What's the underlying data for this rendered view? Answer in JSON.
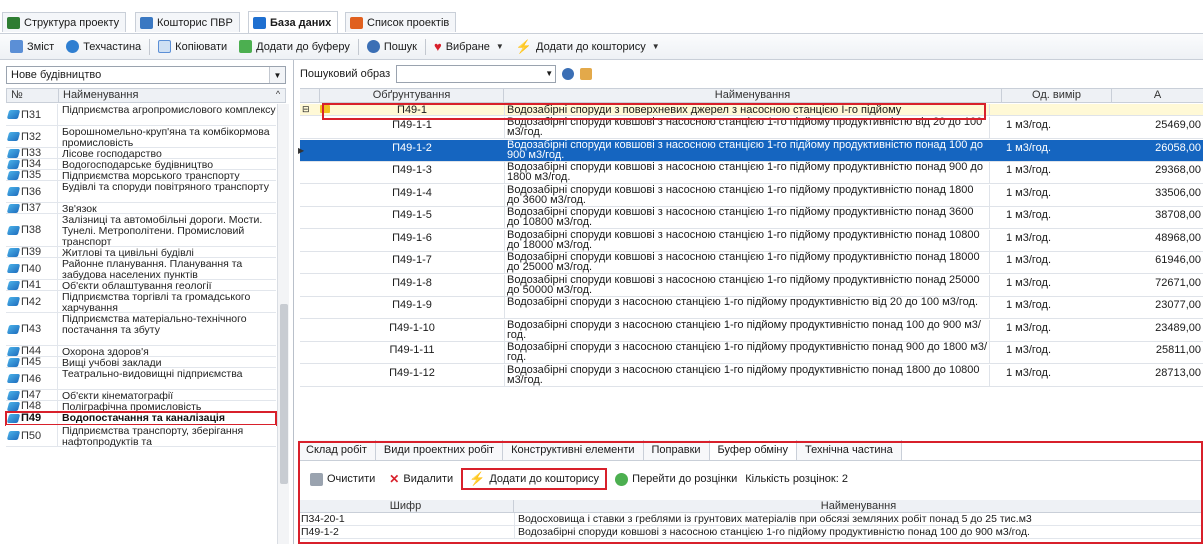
{
  "tabs": [
    {
      "label": "Структура проекту",
      "icon": "structure-icon",
      "color": "#2e7d32"
    },
    {
      "label": "Кошторис ПВР",
      "icon": "table-icon",
      "color": "#3a78c2"
    },
    {
      "label": "База даних",
      "icon": "database-icon",
      "color": "#1e6fd0"
    },
    {
      "label": "Список проектів",
      "icon": "list-icon",
      "color": "#e0601f"
    }
  ],
  "toolbar": {
    "contents": "Зміст",
    "techpart": "Техчастина",
    "copy": "Копіювати",
    "add_buffer": "Додати до буферу",
    "search": "Пошук",
    "favorites": "Вибране",
    "add_estimate": "Додати до кошторису"
  },
  "left": {
    "combo_value": "Нове будівництво",
    "col_num": "№",
    "col_name": "Найменування",
    "items": [
      {
        "code": "П31",
        "name": "Підприємства агропромислового комплексу"
      },
      {
        "code": "П32",
        "name": "Борошномельно-круп'яна та комбікормова промисловість"
      },
      {
        "code": "П33",
        "name": "Лісове господарство"
      },
      {
        "code": "П34",
        "name": "Водогосподарське будівництво"
      },
      {
        "code": "П35",
        "name": "Підприємства морського транспорту"
      },
      {
        "code": "П36",
        "name": "Будівлі та споруди повітряного транспорту"
      },
      {
        "code": "П37",
        "name": "Зв'язок"
      },
      {
        "code": "П38",
        "name": "Залізниці та автомобільні дороги. Мости. Тунелі. Метрополітени. Промисловий транспорт"
      },
      {
        "code": "П39",
        "name": "Житлові та цивільні будівлі"
      },
      {
        "code": "П40",
        "name": "Районне планування. Планування та забудова населених пунктів"
      },
      {
        "code": "П41",
        "name": "Об'єкти облаштування геології"
      },
      {
        "code": "П42",
        "name": "Підприємства торгівлі та громадського харчування"
      },
      {
        "code": "П43",
        "name": "Підприємства матеріально-технічного постачання та збуту"
      },
      {
        "code": "П44",
        "name": "Охорона здоров'я"
      },
      {
        "code": "П45",
        "name": "Вищі учбові заклади"
      },
      {
        "code": "П46",
        "name": "Театрально-видовищні підприємства"
      },
      {
        "code": "П47",
        "name": "Об'єкти кінематографії"
      },
      {
        "code": "П48",
        "name": "Поліграфічна промисловість"
      },
      {
        "code": "П49",
        "name": "Водопостачання та каналізація"
      },
      {
        "code": "П50",
        "name": "Підприємства транспорту, зберігання нафтопродуктів та"
      }
    ]
  },
  "search": {
    "label": "Пошуковий образ",
    "value": ""
  },
  "grid": {
    "headers": {
      "code": "Обґрунтування",
      "name": "Найменування",
      "unit": "Од. вимір",
      "a": "A"
    },
    "group": {
      "code": "П49-1",
      "name": "Водозабірні споруди з поверхневих джерел з насосною станцією І-го підйому"
    },
    "rows": [
      {
        "code": "П49-1-1",
        "name": "Водозабірні споруди ковшові з насосною станцією 1-го підйому продуктивністю від 20 до 100 м3/год.",
        "unit": "1 м3/год.",
        "a": "25469,00"
      },
      {
        "code": "П49-1-2",
        "name": "Водозабірні споруди ковшові з насосною станцією 1-го підйому продуктивністю понад 100 до 900 м3/год.",
        "unit": "1 м3/год.",
        "a": "26058,00"
      },
      {
        "code": "П49-1-3",
        "name": "Водозабірні споруди ковшові з насосною станцією 1-го підйому продуктивністю понад 900 до 1800 м3/год.",
        "unit": "1 м3/год.",
        "a": "29368,00"
      },
      {
        "code": "П49-1-4",
        "name": "Водозабірні споруди ковшові з насосною станцією 1-го підйому продуктивністю понад 1800 до 3600 м3/год.",
        "unit": "1 м3/год.",
        "a": "33506,00"
      },
      {
        "code": "П49-1-5",
        "name": "Водозабірні споруди ковшові з насосною станцією 1-го підйому продуктивністю понад 3600 до 10800 м3/год.",
        "unit": "1 м3/год.",
        "a": "38708,00"
      },
      {
        "code": "П49-1-6",
        "name": "Водозабірні споруди ковшові з насосною станцією 1-го підйому продуктивністю понад 10800 до 18000 м3/год.",
        "unit": "1 м3/год.",
        "a": "48968,00"
      },
      {
        "code": "П49-1-7",
        "name": "Водозабірні споруди ковшові з насосною станцією 1-го підйому продуктивністю понад 18000 до 25000 м3/год.",
        "unit": "1 м3/год.",
        "a": "61946,00"
      },
      {
        "code": "П49-1-8",
        "name": "Водозабірні споруди ковшові з насосною станцією 1-го підйому продуктивністю понад 25000 до 50000 м3/год.",
        "unit": "1 м3/год.",
        "a": "72671,00"
      },
      {
        "code": "П49-1-9",
        "name": "Водозабірні споруди з насосною станцією 1-го підйому продуктивністю від 20 до 100 м3/год.",
        "unit": "1 м3/год.",
        "a": "23077,00"
      },
      {
        "code": "П49-1-10",
        "name": "Водозабірні споруди з насосною станцією 1-го підйому продуктивністю понад 100 до 900 м3/год.",
        "unit": "1 м3/год.",
        "a": "23489,00"
      },
      {
        "code": "П49-1-11",
        "name": "Водозабірні споруди з насосною станцією 1-го підйому продуктивністю понад 900 до 1800 м3/год.",
        "unit": "1 м3/год.",
        "a": "25811,00"
      },
      {
        "code": "П49-1-12",
        "name": "Водозабірні споруди з насосною станцією 1-го підйому продуктивністю понад 1800 до 10800 м3/год.",
        "unit": "1 м3/год.",
        "a": "28713,00"
      }
    ]
  },
  "bottom": {
    "tabs": [
      "Склад робіт",
      "Види проектних робіт",
      "Конструктивні елементи",
      "Поправки",
      "Буфер обміну",
      "Технічна частина"
    ],
    "clear": "Очистити",
    "delete": "Видалити",
    "add_estimate": "Додати до кошторису",
    "goto_pricing": "Перейти до розцінки",
    "count_text": "Кількість розцінок: 2",
    "col_code": "Шифр",
    "col_name": "Найменування",
    "rows": [
      {
        "code": "П34-20-1",
        "name": "Водосховища і ставки з греблями із грунтових матеріалів при обсязі земляних робіт понад 5 до 25 тис.м3"
      },
      {
        "code": "П49-1-2",
        "name": "Водозабірні споруди ковшові з насосною станцією 1-го підйому продуктивністю понад 100 до 900 м3/год."
      }
    ]
  },
  "colors": {
    "selection": "#1565c0",
    "highlight_box": "#d8202b",
    "group_row": "#fff9d6"
  }
}
